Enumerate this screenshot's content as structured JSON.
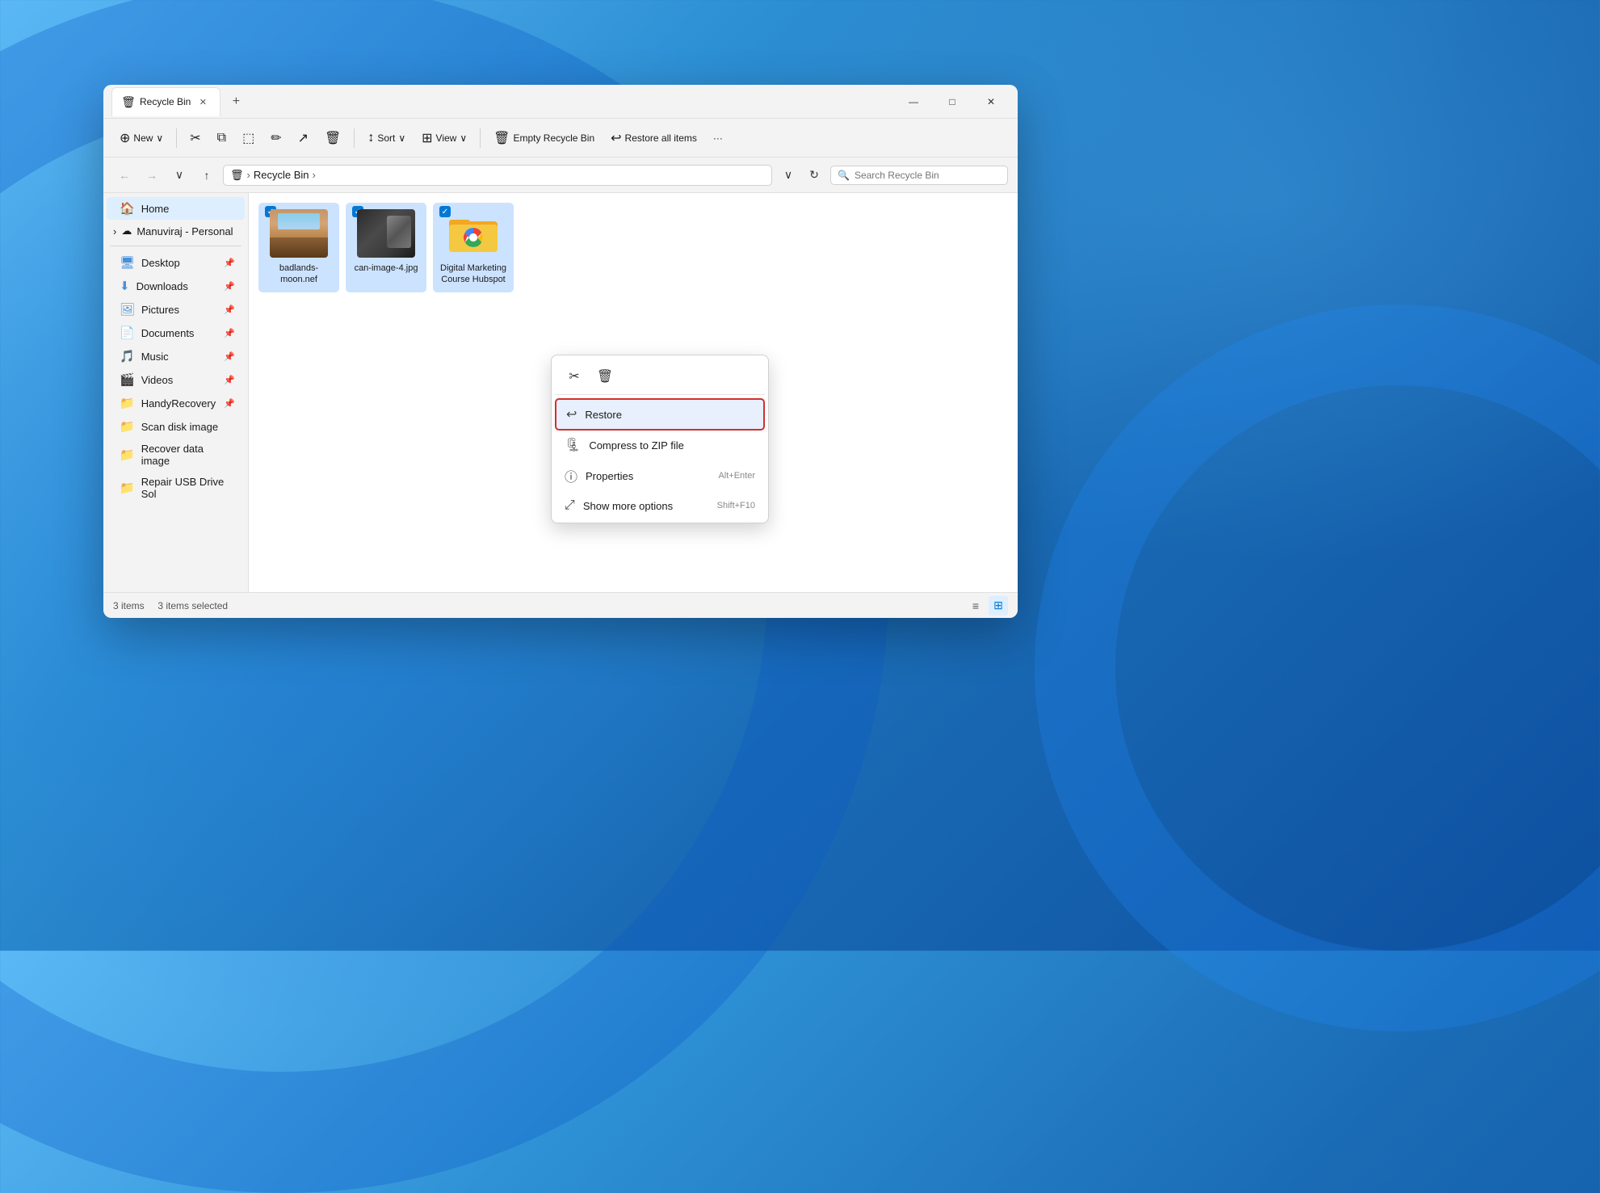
{
  "background": {
    "color_start": "#5bb8f5",
    "color_end": "#0d4fa0"
  },
  "window": {
    "title": "Recycle Bin",
    "tab_label": "Recycle Bin",
    "tab_close_icon": "✕",
    "add_tab_icon": "+"
  },
  "window_controls": {
    "minimize": "—",
    "maximize": "□",
    "close": "✕"
  },
  "toolbar": {
    "new_label": "New",
    "new_arrow": "∨",
    "cut_icon": "✂",
    "copy_icon": "⧉",
    "paste_icon": "📋",
    "rename_icon": "✏",
    "share_icon": "↗",
    "delete_icon": "🗑",
    "sort_label": "Sort",
    "sort_arrow": "∨",
    "view_label": "View",
    "view_arrow": "∨",
    "empty_label": "Empty Recycle Bin",
    "restore_label": "Restore all items",
    "more_icon": "···"
  },
  "address_bar": {
    "back_icon": "←",
    "forward_icon": "→",
    "recent_icon": "∨",
    "up_icon": "↑",
    "recycle_icon": "🗑",
    "path_items": [
      "Recycle Bin"
    ],
    "path_arrow": ">",
    "dropdown_icon": "∨",
    "refresh_icon": "↻",
    "search_placeholder": "Search Recycle Bin",
    "search_icon": "🔍"
  },
  "sidebar": {
    "home_label": "Home",
    "home_icon": "🏠",
    "cloud_group": "Manuviraj - Personal",
    "cloud_icon": "☁",
    "expand_icon": "›",
    "items": [
      {
        "label": "Desktop",
        "icon": "🖥",
        "pinned": true
      },
      {
        "label": "Downloads",
        "icon": "⬇",
        "pinned": true
      },
      {
        "label": "Pictures",
        "icon": "🖼",
        "pinned": true
      },
      {
        "label": "Documents",
        "icon": "📄",
        "pinned": true
      },
      {
        "label": "Music",
        "icon": "🎵",
        "pinned": true
      },
      {
        "label": "Videos",
        "icon": "🎬",
        "pinned": true
      },
      {
        "label": "HandyRecovery",
        "icon": "📁",
        "pinned": true
      },
      {
        "label": "Scan disk image",
        "icon": "📁",
        "pinned": false
      },
      {
        "label": "Recover data image",
        "icon": "📁",
        "pinned": false
      },
      {
        "label": "Repair USB Drive Sol",
        "icon": "📁",
        "pinned": false
      }
    ]
  },
  "files": [
    {
      "name": "badlands-moon.nef",
      "type": "image",
      "selected": true
    },
    {
      "name": "can-image-4.jpg",
      "type": "image",
      "selected": true
    },
    {
      "name": "Digital Marketing Course Hubspot",
      "type": "folder",
      "selected": true
    }
  ],
  "status_bar": {
    "items_count": "3 items",
    "selected_count": "3 items selected",
    "list_view_icon": "≡",
    "grid_view_icon": "⊞"
  },
  "context_menu": {
    "cut_icon": "✂",
    "delete_icon": "🗑",
    "restore_label": "Restore",
    "restore_icon": "↩",
    "compress_label": "Compress to ZIP file",
    "compress_icon": "🗜",
    "properties_label": "Properties",
    "properties_icon": "ⓘ",
    "properties_shortcut": "Alt+Enter",
    "more_label": "Show more options",
    "more_icon": "⤢",
    "more_shortcut": "Shift+F10"
  }
}
